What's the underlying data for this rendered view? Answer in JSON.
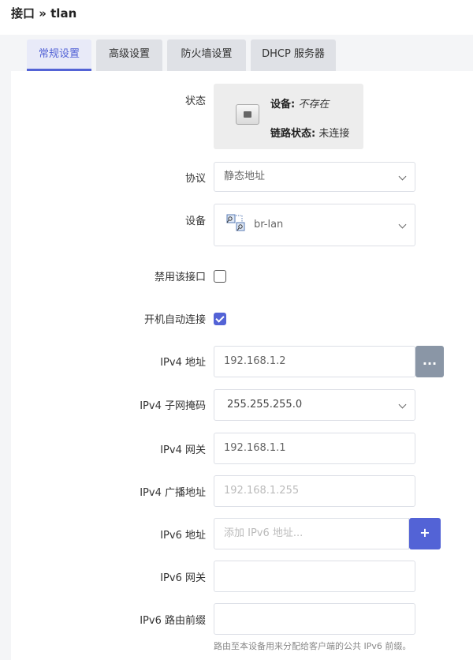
{
  "header": {
    "title": "接口 » tlan"
  },
  "tabs": [
    {
      "label": "常规设置",
      "active": true
    },
    {
      "label": "高级设置",
      "active": false
    },
    {
      "label": "防火墙设置",
      "active": false
    },
    {
      "label": "DHCP 服务器",
      "active": false
    }
  ],
  "status": {
    "label": "状态",
    "device_key": "设备:",
    "device_value": "不存在",
    "link_key": "链路状态:",
    "link_value": "未连接",
    "icon": "ethernet-port-icon"
  },
  "protocol": {
    "label": "协议",
    "value": "静态地址"
  },
  "device": {
    "label": "设备",
    "value": "br-lan",
    "icon": "bridge-icon"
  },
  "disable_iface": {
    "label": "禁用该接口",
    "checked": false
  },
  "auto_start": {
    "label": "开机自动连接",
    "checked": true
  },
  "ipv4_addr": {
    "label": "IPv4 地址",
    "value": "192.168.1.2",
    "button": "..."
  },
  "ipv4_mask": {
    "label": "IPv4 子网掩码",
    "value": "255.255.255.0"
  },
  "ipv4_gw": {
    "label": "IPv4 网关",
    "value": "192.168.1.1"
  },
  "ipv4_bcast": {
    "label": "IPv4 广播地址",
    "placeholder": "192.168.1.255"
  },
  "ipv6_addr": {
    "label": "IPv6 地址",
    "placeholder": "添加 IPv6 地址...",
    "button": "+"
  },
  "ipv6_gw": {
    "label": "IPv6 网关",
    "value": ""
  },
  "ipv6_prefix": {
    "label": "IPv6 路由前缀",
    "value": "",
    "hint": "路由至本设备用来分配给客户端的公共 IPv6 前缀。"
  },
  "colors": {
    "accent": "#5363d6",
    "gray_button": "#8a96a6"
  }
}
